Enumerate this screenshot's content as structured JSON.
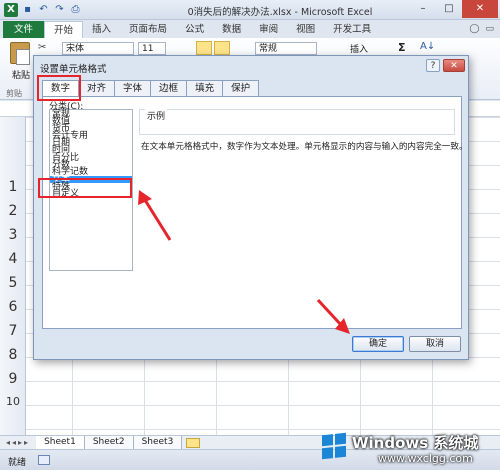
{
  "titlebar": {
    "app_icon_letter": "X",
    "title": "0消失后的解决办法.xlsx - Microsoft Excel",
    "window_controls": [
      "–",
      "□",
      "✕"
    ]
  },
  "ribbon_tabs": [
    "文件",
    "开始",
    "插入",
    "页面布局",
    "公式",
    "数据",
    "审阅",
    "视图",
    "开发工具"
  ],
  "ribbon": {
    "paste_label": "粘贴",
    "font_name": "宋体",
    "font_size": "11",
    "number_format": "常规",
    "insert_label": "插入",
    "sigma": "Σ",
    "sort_symbol": "A↓",
    "clipboard_group": "剪贴"
  },
  "sheet": {
    "row_numbers": [
      "1",
      "2",
      "3",
      "4",
      "5",
      "6",
      "7",
      "8",
      "9",
      "10"
    ],
    "tabs": [
      "Sheet1",
      "Sheet2",
      "Sheet3"
    ],
    "status": "就绪"
  },
  "dialog": {
    "title": "设置单元格格式",
    "help": "?",
    "close": "✕",
    "tabs": [
      "数字",
      "对齐",
      "字体",
      "边框",
      "填充",
      "保护"
    ],
    "category_label": "分类(C):",
    "categories": [
      "常规",
      "数值",
      "货币",
      "会计专用",
      "日期",
      "时间",
      "百分比",
      "分数",
      "科学记数",
      "文本",
      "特殊",
      "自定义"
    ],
    "selected_category": "文本",
    "sample_label": "示例",
    "description": "在文本单元格格式中，数字作为文本处理。单元格显示的内容与输入的内容完全一致。",
    "ok": "确定",
    "cancel": "取消"
  },
  "watermark": {
    "title": "Windows 系统城",
    "url": "www.wxclgg.com"
  },
  "colors": {
    "highlight": "#e5242b",
    "selection": "#3399ff",
    "excel_green": "#1f7a3e"
  }
}
